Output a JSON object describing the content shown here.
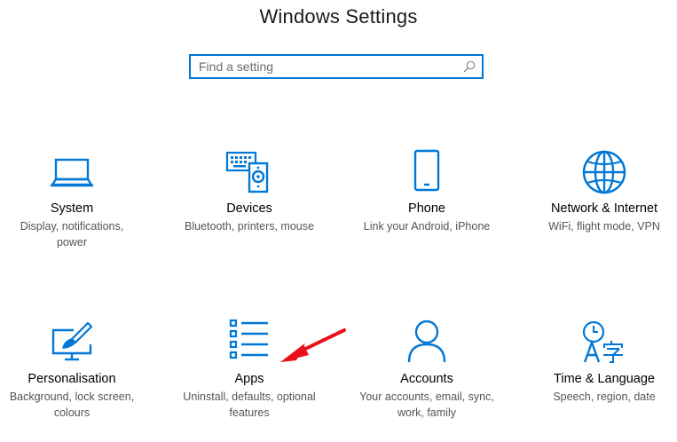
{
  "window": {
    "title": "Windows Settings"
  },
  "search": {
    "placeholder": "Find a setting"
  },
  "accent_color": "#0078d7",
  "annotation_color": "#e8101a",
  "tiles": [
    {
      "name": "System",
      "description": "Display, notifications, power",
      "icon": "laptop-icon"
    },
    {
      "name": "Devices",
      "description": "Bluetooth, printers, mouse",
      "icon": "devices-icon"
    },
    {
      "name": "Phone",
      "description": "Link your Android, iPhone",
      "icon": "phone-icon"
    },
    {
      "name": "Network & Internet",
      "description": "WiFi, flight mode, VPN",
      "icon": "globe-icon"
    },
    {
      "name": "Personalisation",
      "description": "Background, lock screen, colours",
      "icon": "paint-monitor-icon"
    },
    {
      "name": "Apps",
      "description": "Uninstall, defaults, optional features",
      "icon": "apps-list-icon"
    },
    {
      "name": "Accounts",
      "description": "Your accounts, email, sync, work, family",
      "icon": "person-icon"
    },
    {
      "name": "Time & Language",
      "description": "Speech, region, date",
      "icon": "time-language-icon"
    }
  ]
}
